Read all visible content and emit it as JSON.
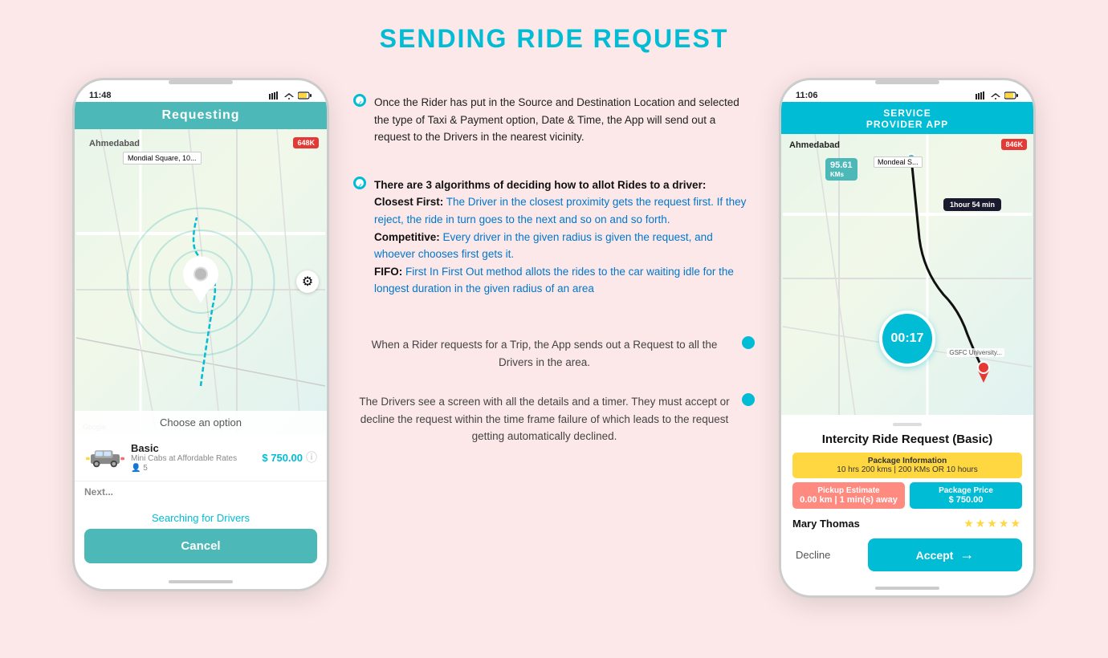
{
  "page": {
    "title": "SENDING RIDE REQUEST",
    "bg_color": "#fce8e8"
  },
  "left_phone": {
    "status_bar": {
      "time": "11:48",
      "icons": "▲ ≡ ⚡"
    },
    "header": "Requesting",
    "map": {
      "city_label": "Ahmedabad",
      "badge": "648K",
      "choose_option": "Choose an option"
    },
    "car_option": {
      "name": "Basic",
      "desc": "Mini Cabs at Affordable Rates",
      "people": "5",
      "price": "$ 750.00"
    },
    "searching_text": "Searching for Drivers",
    "cancel_button": "Cancel"
  },
  "middle": {
    "bullet1": "Once the Rider has put in the Source and Destination Location and selected the type of Taxi & Payment option, Date & Time, the App will send out a request to the Drivers in the nearest vicinity.",
    "bullet2_intro": "There are 3 algorithms of deciding how to allot Rides to a driver:",
    "bullet2_closest_label": "Closest First:",
    "bullet2_closest": " The Driver in the closest proximity gets the request first. If they reject, the ride in turn goes to the next and so on and so forth.",
    "bullet2_competitive_label": "Competitive:",
    "bullet2_competitive": " Every driver in the given radius is given the request, and whoever chooses first gets it.",
    "bullet2_fifo_label": "FIFO:",
    "bullet2_fifo": " First In First Out method allots the rides to the car waiting idle for the longest duration in the given radius of an area",
    "center1": "When a Rider requests for a Trip, the App sends out a Request to all the Drivers in the area.",
    "center2": "The Drivers see a screen with all the details and a timer. They must accept or decline the request within the time frame failure of which leads to the request getting automatically declined."
  },
  "right_phone": {
    "status_bar": {
      "time": "11:06",
      "icons": "▲ ≡ ⚡"
    },
    "header": {
      "line1": "SERVICE",
      "line2": "PROVIDER APP"
    },
    "map": {
      "city_label": "Ahmedabad",
      "badge": "846K",
      "distance_badge": "95.61\nKMs",
      "mondeal_label": "Mondeal S...",
      "time_badge": "1hour 54 min",
      "gsfc_label": "GSFC University...",
      "timer": "00:17"
    },
    "ride_card": {
      "title": "Intercity Ride Request (Basic)",
      "pkg_label": "Package Information",
      "pkg_value": "10 hrs 200 kms  |  200 KMs OR 10 hours",
      "pickup_label": "Pickup Estimate",
      "pickup_value": "0.00 km  |  1 min(s) away",
      "price_label": "Package Price",
      "price_value": "$ 750.00",
      "user_name": "Mary Thomas",
      "stars": "★★★★★",
      "decline_button": "Decline",
      "accept_button": "Accept"
    }
  }
}
